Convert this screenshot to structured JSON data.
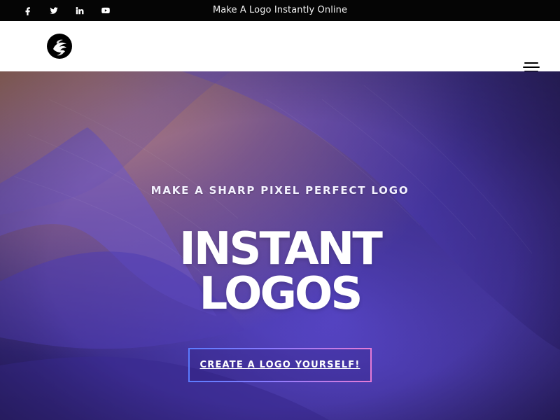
{
  "topbar": {
    "social": [
      {
        "icon": "facebook-icon"
      },
      {
        "icon": "twitter-icon"
      },
      {
        "icon": "linkedin-icon"
      },
      {
        "icon": "youtube-icon"
      }
    ],
    "message": "Make A Logo Instantly Online"
  },
  "header": {
    "logo_icon": "bird-logo-icon",
    "menu_icon": "hamburger-menu-icon"
  },
  "hero": {
    "subtitle": "MAKE A SHARP PIXEL PERFECT LOGO",
    "title_line1": "INSTANT",
    "title_line2": "LOGOS",
    "cta_label": "CREATE A LOGO YOURSELF!"
  },
  "colors": {
    "topbar_bg": "#050505",
    "header_bg": "#ffffff",
    "cta_border_start": "#5b7cff",
    "cta_border_end": "#e77bd6"
  }
}
